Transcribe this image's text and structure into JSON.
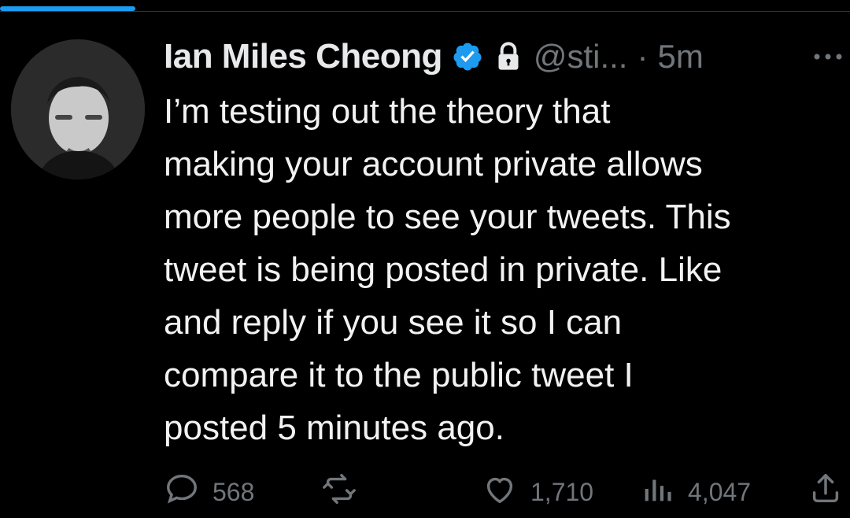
{
  "tweet": {
    "author_name": "Ian Miles Cheong",
    "handle": "@sti...",
    "separator": "·",
    "time_ago": "5m",
    "text_lines": [
      "I’m testing out the theory that",
      "making your account private allows",
      "more people to see your tweets. This",
      "tweet is being posted in private. Like",
      "and reply if you see it so I can",
      "compare it to the public tweet I",
      "posted 5 minutes ago."
    ]
  },
  "actions": {
    "reply_count": "568",
    "retweet_count": "",
    "like_count": "1,710",
    "views_count": "4,047"
  },
  "icons": {
    "verified": "verified-badge-icon",
    "lock": "lock-icon",
    "more": "more-icon",
    "reply": "reply-icon",
    "retweet": "retweet-icon",
    "like": "heart-icon",
    "views": "views-icon",
    "share": "share-icon"
  },
  "colors": {
    "accent": "#1d9bf0",
    "background": "#000000",
    "text": "#e7e9ea",
    "muted": "#71767b"
  }
}
